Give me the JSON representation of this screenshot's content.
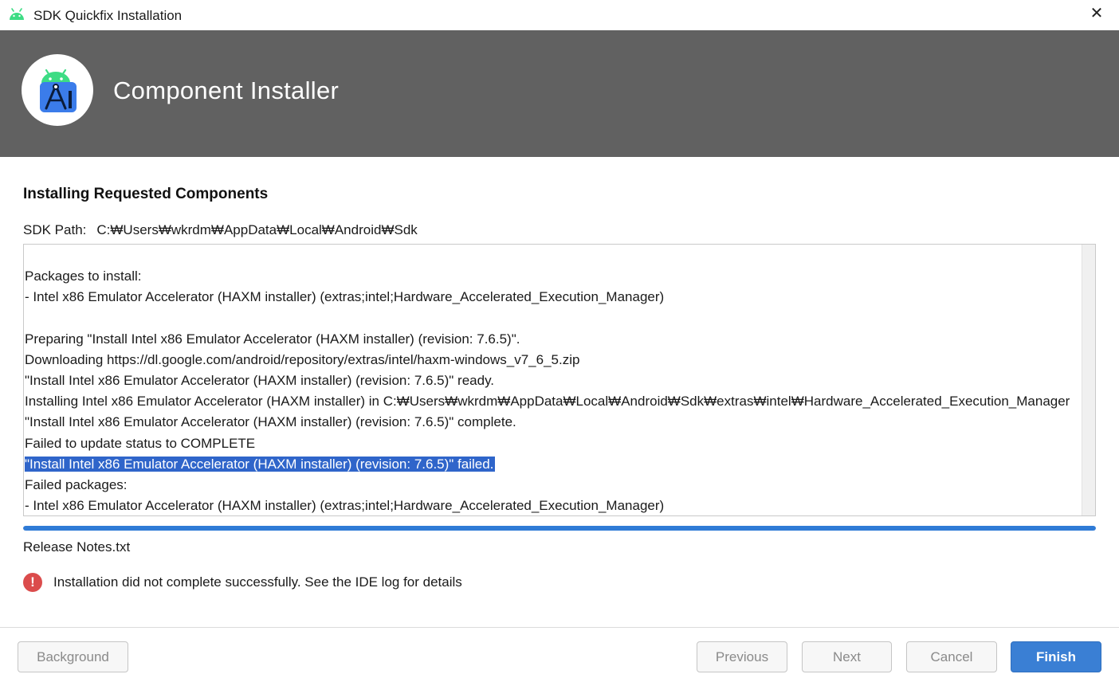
{
  "window": {
    "title": "SDK Quickfix Installation",
    "close_glyph": "✕",
    "app_icon": "android-icon"
  },
  "banner": {
    "title": "Component Installer",
    "logo": "android-studio-logo",
    "background_color": "#616161"
  },
  "main": {
    "section_title": "Installing Requested Components",
    "sdk_path_label": "SDK Path:",
    "sdk_path_value": "C:₩Users₩wkrdm₩AppData₩Local₩Android₩Sdk",
    "log_lines": [
      "Packages to install:",
      "- Intel x86 Emulator Accelerator (HAXM installer) (extras;intel;Hardware_Accelerated_Execution_Manager)",
      "",
      "Preparing \"Install Intel x86 Emulator Accelerator (HAXM installer) (revision: 7.6.5)\".",
      "Downloading https://dl.google.com/android/repository/extras/intel/haxm-windows_v7_6_5.zip",
      "\"Install Intel x86 Emulator Accelerator (HAXM installer) (revision: 7.6.5)\" ready.",
      "Installing Intel x86 Emulator Accelerator (HAXM installer) in C:₩Users₩wkrdm₩AppData₩Local₩Android₩Sdk₩extras₩intel₩Hardware_Accelerated_Execution_Manager",
      "\"Install Intel x86 Emulator Accelerator (HAXM installer) (revision: 7.6.5)\" complete.",
      "Failed to update status to COMPLETE",
      "\"Install Intel x86 Emulator Accelerator (HAXM installer) (revision: 7.6.5)\" failed.",
      "Failed packages:",
      "- Intel x86 Emulator Accelerator (HAXM installer) (extras;intel;Hardware_Accelerated_Execution_Manager)"
    ],
    "selected_line_index": 9,
    "selection_color": "#2f65ca",
    "progress_percent": 100,
    "progress_color": "#2f7bd6",
    "release_notes_link": "Release Notes.txt",
    "error_icon": "error-icon",
    "error_glyph": "!",
    "error_message": "Installation did not complete successfully. See the IDE log for details",
    "error_color": "#db4c4c"
  },
  "footer": {
    "background_label": "Background",
    "previous_label": "Previous",
    "next_label": "Next",
    "cancel_label": "Cancel",
    "finish_label": "Finish",
    "primary_color": "#3a7fd4"
  }
}
